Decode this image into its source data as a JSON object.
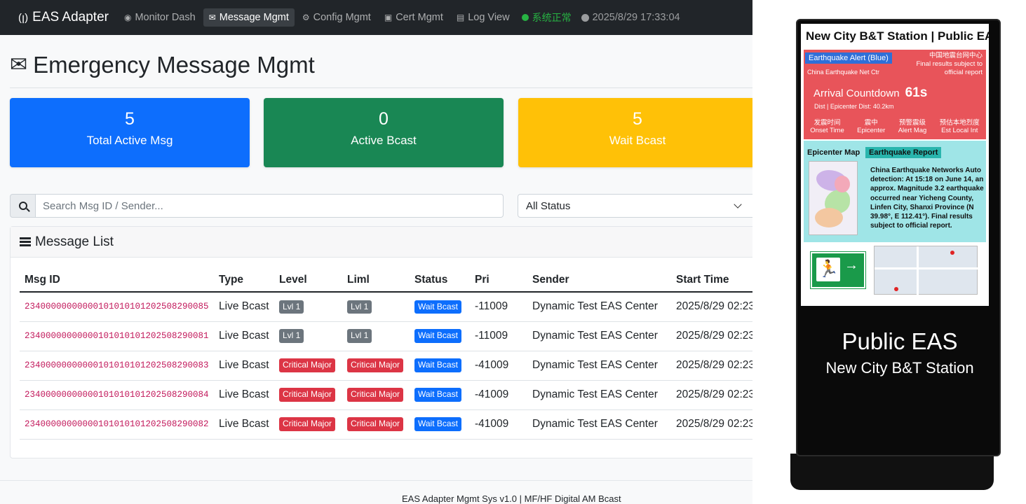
{
  "navbar": {
    "brand": "EAS Adapter",
    "items": [
      {
        "label": "Monitor Dash",
        "icon": "dashboard-icon"
      },
      {
        "label": "Message Mgmt",
        "icon": "envelope-icon",
        "active": true
      },
      {
        "label": "Config Mgmt",
        "icon": "gear-icon"
      },
      {
        "label": "Cert Mgmt",
        "icon": "certificate-icon"
      },
      {
        "label": "Log View",
        "icon": "file-icon"
      }
    ],
    "status": "系统正常",
    "clock": "2025/8/29 17:33:04"
  },
  "page": {
    "title": "Emergency Message Mgmt"
  },
  "stats": [
    {
      "value": "5",
      "label": "Total Active Msg",
      "color": "#0d6efd"
    },
    {
      "value": "0",
      "label": "Active Bcast",
      "color": "#198754"
    },
    {
      "value": "5",
      "label": "Wait Bcast",
      "color": "#ffc107"
    }
  ],
  "search": {
    "placeholder": "Search Msg ID / Sender...",
    "value": ""
  },
  "status_filter": {
    "selected": "All Status"
  },
  "message_list": {
    "title": "Message List",
    "columns": [
      "Msg ID",
      "Type",
      "Level",
      "Liml",
      "Status",
      "Pri",
      "Sender",
      "Start Time"
    ],
    "rows": [
      {
        "id": "23400000000000101010101202508290085",
        "type": "Live Bcast",
        "level": "Lvl 1",
        "liml": "Lvl 1",
        "status": "Wait Bcast",
        "pri": "-11009",
        "sender": "Dynamic Test EAS Center",
        "start": "2025/8/29 02:23"
      },
      {
        "id": "23400000000000101010101202508290081",
        "type": "Live Bcast",
        "level": "Lvl 1",
        "liml": "Lvl 1",
        "status": "Wait Bcast",
        "pri": "-11009",
        "sender": "Dynamic Test EAS Center",
        "start": "2025/8/29 02:23"
      },
      {
        "id": "23400000000000101010101202508290083",
        "type": "Live Bcast",
        "level": "Critical Major",
        "liml": "Critical Major",
        "status": "Wait Bcast",
        "pri": "-41009",
        "sender": "Dynamic Test EAS Center",
        "start": "2025/8/29 02:23"
      },
      {
        "id": "23400000000000101010101202508290084",
        "type": "Live Bcast",
        "level": "Critical Major",
        "liml": "Critical Major",
        "status": "Wait Bcast",
        "pri": "-41009",
        "sender": "Dynamic Test EAS Center",
        "start": "2025/8/29 02:23"
      },
      {
        "id": "23400000000000101010101202508290082",
        "type": "Live Bcast",
        "level": "Critical Major",
        "liml": "Critical Major",
        "status": "Wait Bcast",
        "pri": "-41009",
        "sender": "Dynamic Test EAS Center",
        "start": "2025/8/29 02:23"
      }
    ]
  },
  "footer": "EAS Adapter Mgmt Sys v1.0 | MF/HF Digital AM Bcast",
  "kiosk": {
    "screen_title": "New City B&T Station | Public EAS",
    "alert_tag": "Earthquake Alert (Blue)",
    "alert_source": "China Earthquake Net Ctr",
    "alert_note_cn": "中国地震台网中心",
    "alert_note": "Final results subject to official report",
    "countdown_label": "Arrival Countdown",
    "countdown_value": "61s",
    "distance": "Dist | Epicenter Dist: 40.2km",
    "metrics": [
      {
        "cn": "发震时间",
        "en": "Onset Time"
      },
      {
        "cn": "震中",
        "en": "Epicenter"
      },
      {
        "cn": "预警震级",
        "en": "Alert Mag"
      },
      {
        "cn": "预估本地烈度",
        "en": "Est Local Int"
      }
    ],
    "map_label": "Epicenter Map",
    "report_tag": "Earthquake Report",
    "report_text": "China Earthquake Networks Auto detection: At 15:18 on June 14, an approx. Magnitude 3.2 earthquake occurred near Yicheng County, Linfen City, Shanxi Province (N 39.98°, E 112.41°). Final results subject to official report.",
    "big_title": "Public EAS",
    "big_sub": "New City B&T Station"
  }
}
